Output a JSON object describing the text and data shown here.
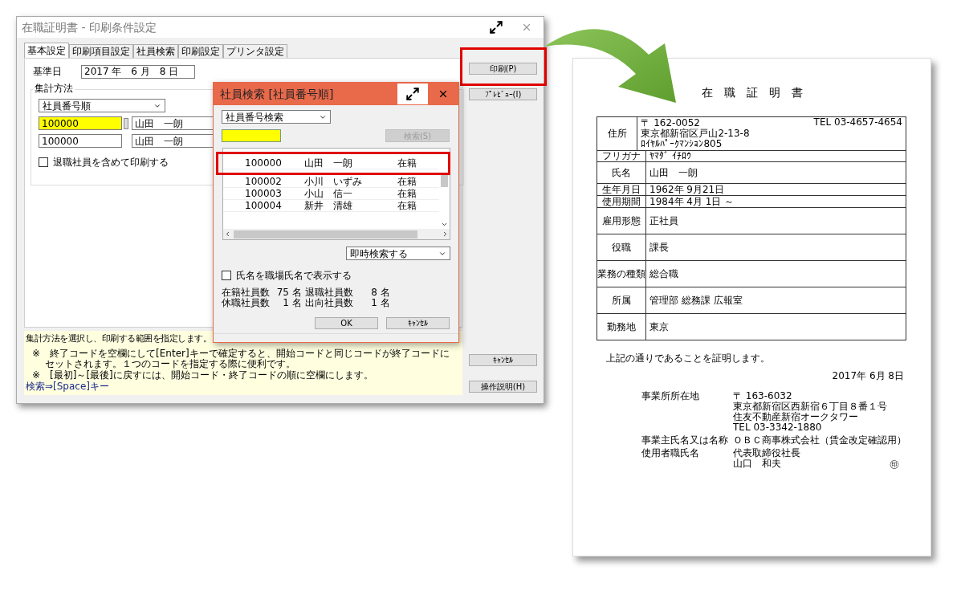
{
  "main_window": {
    "title": "在職証明書 - 印刷条件設定",
    "tabs": [
      {
        "label": "基本設定",
        "selected": true
      },
      {
        "label": "印刷項目設定",
        "selected": false
      },
      {
        "label": "社員検索",
        "selected": false
      },
      {
        "label": "印刷設定",
        "selected": false
      },
      {
        "label": "プリンタ設定",
        "selected": false
      }
    ],
    "base_date": {
      "label": "基準日",
      "value": "2017 年　6 月　8 日"
    },
    "group": {
      "label": "集計方法",
      "sort_select": "社員番号順",
      "ranges": [
        {
          "code": "100000",
          "name": "山田　一朗",
          "focused": true
        },
        {
          "code": "100000",
          "name": "山田　一朗",
          "focused": false
        }
      ],
      "checkbox": {
        "label": "退職社員を含めて印刷する",
        "checked": false
      }
    },
    "help": {
      "lines": [
        "集計方法を選択し、印刷する範囲を指定します。",
        "※　終了コードを空欄にして[Enter]キーで確定すると、開始コードと同じコードが終了コードにセットされます。１つのコードを指定する際に便利です。",
        "※　[最初]～[最後]に戻すには、開始コード・終了コードの順に空欄にします。"
      ],
      "link": "検索⇒[Space]キー"
    },
    "buttons": [
      {
        "label": "印刷(P)",
        "annotated": true
      },
      {
        "label": "ﾌﾟﾚﾋﾞｭｰ(I)",
        "annotated": false
      },
      {
        "label": "ｷｬﾝｾﾙ",
        "annotated": false
      },
      {
        "label": "操作説明(H)",
        "annotated": false
      }
    ]
  },
  "dialog": {
    "title": "社員検索 [社員番号順]",
    "search_select": "社員番号検索",
    "search_button": {
      "label": "検索(S)",
      "disabled": true
    },
    "rows": [
      {
        "code": "100000",
        "name": "山田　一朗",
        "status": "在籍",
        "annotated": true
      },
      {
        "code": "100002",
        "name": "小川　いずみ",
        "status": "在籍",
        "annotated": false
      },
      {
        "code": "100003",
        "name": "小山　信一",
        "status": "在籍",
        "annotated": false
      },
      {
        "code": "100004",
        "name": "新井　清雄",
        "status": "在籍",
        "annotated": false
      }
    ],
    "mode_select": "即時検索する",
    "checkbox": {
      "label": "氏名を職場氏名で表示する",
      "checked": false
    },
    "stats": [
      {
        "label": "在籍社員数",
        "value": "75",
        "unit": "名"
      },
      {
        "label": "退職社員数",
        "value": "8",
        "unit": "名"
      },
      {
        "label": "休職社員数",
        "value": "1",
        "unit": "名"
      },
      {
        "label": "出向社員数",
        "value": "1",
        "unit": "名"
      }
    ],
    "buttons": [
      "OK",
      "ｷｬﾝｾﾙ"
    ]
  },
  "document": {
    "title": "在　職　証　明　書",
    "rows": [
      {
        "label": "住所",
        "kind": "address",
        "lines": [
          "〒 162-0052",
          "東京都新宿区戸山2-13-8",
          "ﾛｲﾔﾙﾊﾟｰｸﾏﾝｼｮﾝ805"
        ],
        "tel": "TEL 03-4657-4654"
      },
      {
        "label": "フリガナ",
        "kind": "short",
        "lines": [
          "ﾔﾏﾀﾞ ｲﾁﾛｳ"
        ]
      },
      {
        "label": "氏名",
        "kind": "name",
        "lines": [
          "山田　一朗"
        ]
      },
      {
        "label": "生年月日",
        "kind": "mid",
        "lines": [
          "1962年 9月21日"
        ]
      },
      {
        "label": "使用期間",
        "kind": "mid",
        "lines": [
          "1984年 4月 1日 ～"
        ]
      },
      {
        "label": "雇用形態",
        "kind": "tall",
        "lines": [
          "正社員"
        ]
      },
      {
        "label": "役職",
        "kind": "tall",
        "lines": [
          "課長"
        ]
      },
      {
        "label": "業務の種類",
        "kind": "tall",
        "lines": [
          "総合職"
        ]
      },
      {
        "label": "所属",
        "kind": "tall",
        "lines": [
          "管理部 総務課 広報室"
        ]
      },
      {
        "label": "勤務地",
        "kind": "tall",
        "lines": [
          "東京"
        ]
      }
    ],
    "statement": "上記の通りであることを証明します。",
    "date": "2017年 6月 8日",
    "employer": [
      {
        "label": "事業所所在地",
        "lines": [
          "〒 163-6032",
          "東京都新宿区西新宿６丁目８番１号",
          "住友不動産新宿オークタワー",
          "TEL 03-3342-1880"
        ]
      },
      {
        "label": "事業主氏名又は名称",
        "lines": [
          "ＯＢＣ商事株式会社（賃金改定確認用）"
        ]
      },
      {
        "label": "使用者職氏名",
        "lines": [
          "代表取締役社長",
          "山口　和夫"
        ]
      }
    ],
    "seal": "㊞"
  }
}
